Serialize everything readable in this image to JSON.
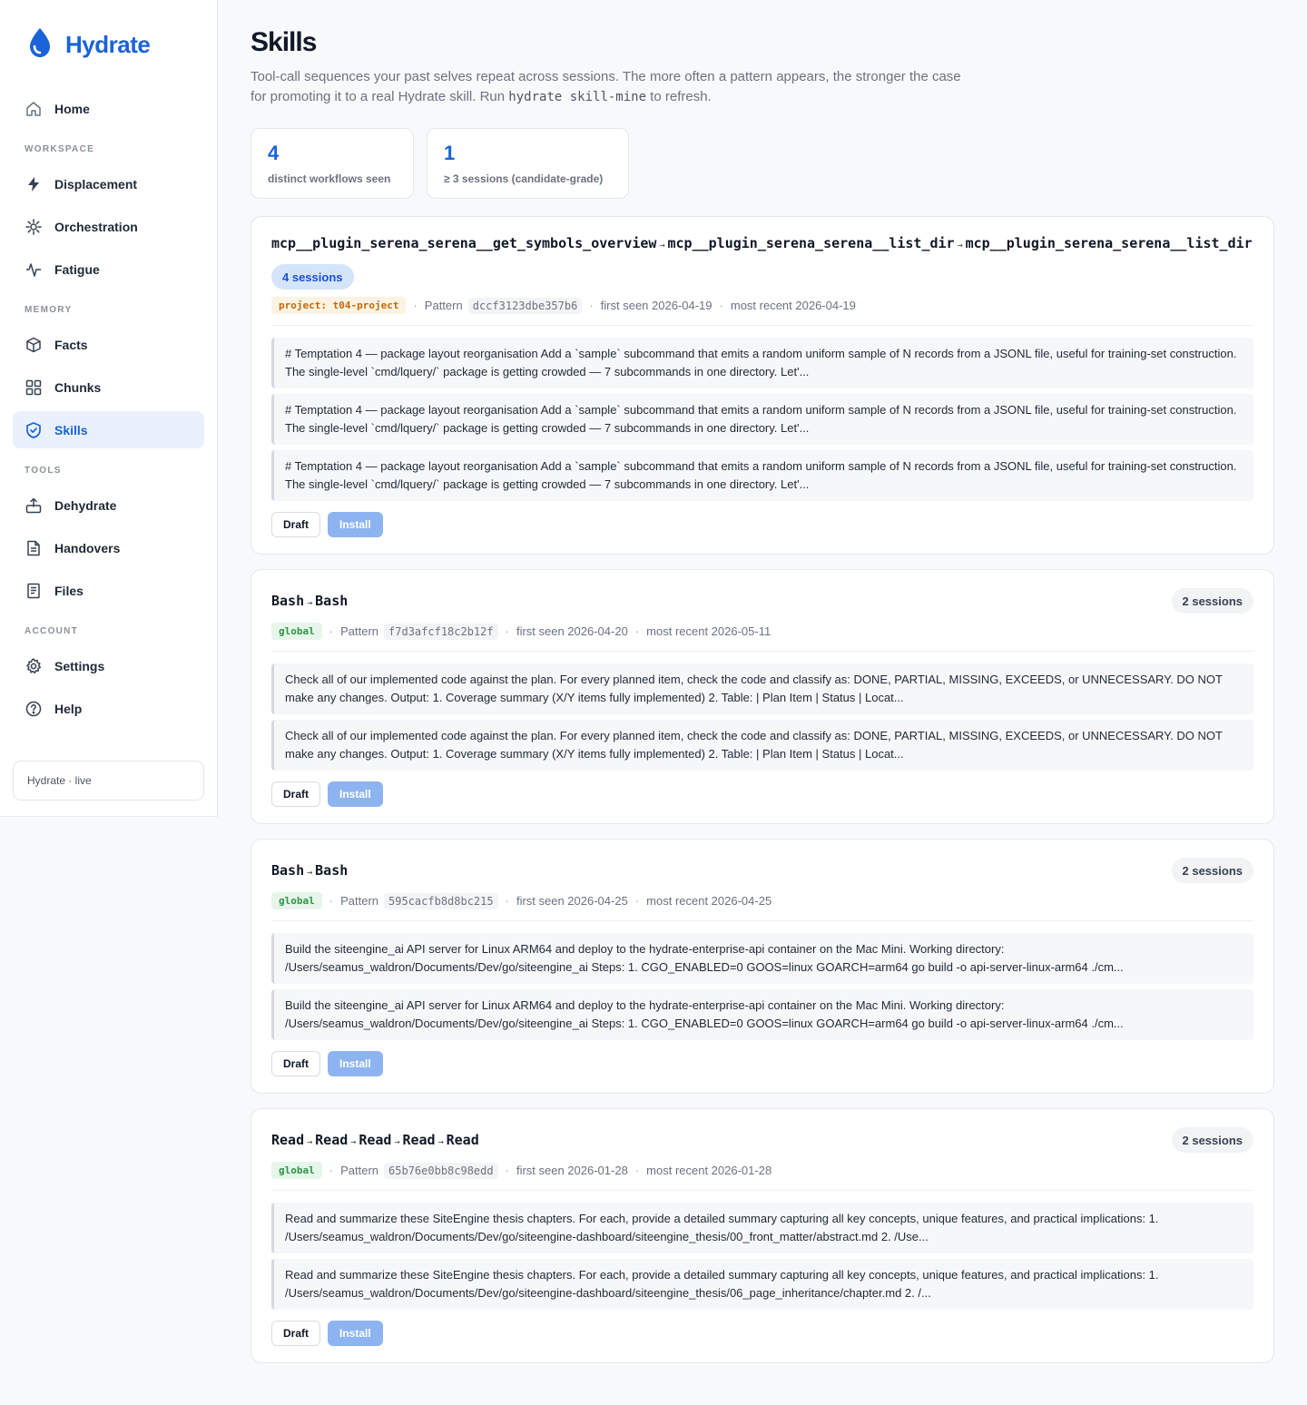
{
  "app": {
    "name": "Hydrate"
  },
  "nav": {
    "home": "Home",
    "sections": {
      "workspace": "WORKSPACE",
      "memory": "MEMORY",
      "tools": "TOOLS",
      "account": "ACCOUNT"
    },
    "workspace": [
      "Displacement",
      "Orchestration",
      "Fatigue"
    ],
    "memory": [
      "Facts",
      "Chunks",
      "Skills"
    ],
    "tools": [
      "Dehydrate",
      "Handovers",
      "Files"
    ],
    "account": [
      "Settings",
      "Help"
    ],
    "active": "Skills"
  },
  "status": "Hydrate · live",
  "page": {
    "title": "Skills",
    "subtitle_pre": "Tool-call sequences your past selves repeat across sessions. The more often a pattern appears, the stronger the case for promoting it to a real Hydrate skill. Run ",
    "subtitle_code": "hydrate skill-mine",
    "subtitle_post": " to refresh."
  },
  "stats": [
    {
      "value": "4",
      "label": "distinct workflows seen"
    },
    {
      "value": "1",
      "label": "≥ 3 sessions (candidate-grade)"
    }
  ],
  "labels": {
    "pattern": "Pattern",
    "draft": "Draft",
    "install": "Install",
    "arrow": "→"
  },
  "cards": [
    {
      "steps": [
        "mcp__plugin_serena_serena__get_symbols_overview",
        "mcp__plugin_serena_serena__list_dir",
        "mcp__plugin_serena_serena__list_dir"
      ],
      "sessions": "4 sessions",
      "scope": "project: t04-project",
      "hash": "dccf3123dbe357b6",
      "first_seen": "first seen 2026-04-19",
      "most_recent": "most recent 2026-04-19",
      "samples": [
        "# Temptation 4 — package layout reorganisation Add a `sample` subcommand that emits a random uniform sample of N records from a JSONL file, useful for training-set construction. The single-level `cmd/lquery/` package is getting crowded — 7 subcommands in one directory. Let'...",
        "# Temptation 4 — package layout reorganisation Add a `sample` subcommand that emits a random uniform sample of N records from a JSONL file, useful for training-set construction. The single-level `cmd/lquery/` package is getting crowded — 7 subcommands in one directory. Let'...",
        "# Temptation 4 — package layout reorganisation Add a `sample` subcommand that emits a random uniform sample of N records from a JSONL file, useful for training-set construction. The single-level `cmd/lquery/` package is getting crowded — 7 subcommands in one directory. Let'..."
      ]
    },
    {
      "steps": [
        "Bash",
        "Bash"
      ],
      "sessions": "2 sessions",
      "scope": "global",
      "hash": "f7d3afcf18c2b12f",
      "first_seen": "first seen 2026-04-20",
      "most_recent": "most recent 2026-05-11",
      "samples": [
        "Check all of our implemented code against the plan. For every planned item, check the code and classify as: DONE, PARTIAL, MISSING, EXCEEDS, or UNNECESSARY. DO NOT make any changes. Output: 1. Coverage summary (X/Y items fully implemented) 2. Table: | Plan Item | Status | Locat...",
        "Check all of our implemented code against the plan. For every planned item, check the code and classify as: DONE, PARTIAL, MISSING, EXCEEDS, or UNNECESSARY. DO NOT make any changes. Output: 1. Coverage summary (X/Y items fully implemented) 2. Table: | Plan Item | Status | Locat..."
      ]
    },
    {
      "steps": [
        "Bash",
        "Bash"
      ],
      "sessions": "2 sessions",
      "scope": "global",
      "hash": "595cacfb8d8bc215",
      "first_seen": "first seen 2026-04-25",
      "most_recent": "most recent 2026-04-25",
      "samples": [
        "Build the siteengine_ai API server for Linux ARM64 and deploy to the hydrate-enterprise-api container on the Mac Mini. Working directory: /Users/seamus_waldron/Documents/Dev/go/siteengine_ai Steps: 1. CGO_ENABLED=0 GOOS=linux GOARCH=arm64 go build -o api-server-linux-arm64 ./cm...",
        "Build the siteengine_ai API server for Linux ARM64 and deploy to the hydrate-enterprise-api container on the Mac Mini. Working directory: /Users/seamus_waldron/Documents/Dev/go/siteengine_ai Steps: 1. CGO_ENABLED=0 GOOS=linux GOARCH=arm64 go build -o api-server-linux-arm64 ./cm..."
      ]
    },
    {
      "steps": [
        "Read",
        "Read",
        "Read",
        "Read",
        "Read"
      ],
      "sessions": "2 sessions",
      "scope": "global",
      "hash": "65b76e0bb8c98edd",
      "first_seen": "first seen 2026-01-28",
      "most_recent": "most recent 2026-01-28",
      "samples": [
        "Read and summarize these SiteEngine thesis chapters. For each, provide a detailed summary capturing all key concepts, unique features, and practical implications: 1. /Users/seamus_waldron/Documents/Dev/go/siteengine-dashboard/siteengine_thesis/00_front_matter/abstract.md 2. /Use...",
        "Read and summarize these SiteEngine thesis chapters. For each, provide a detailed summary capturing all key concepts, unique features, and practical implications: 1. /Users/seamus_waldron/Documents/Dev/go/siteengine-dashboard/siteengine_thesis/06_page_inheritance/chapter.md 2. /..."
      ]
    }
  ]
}
